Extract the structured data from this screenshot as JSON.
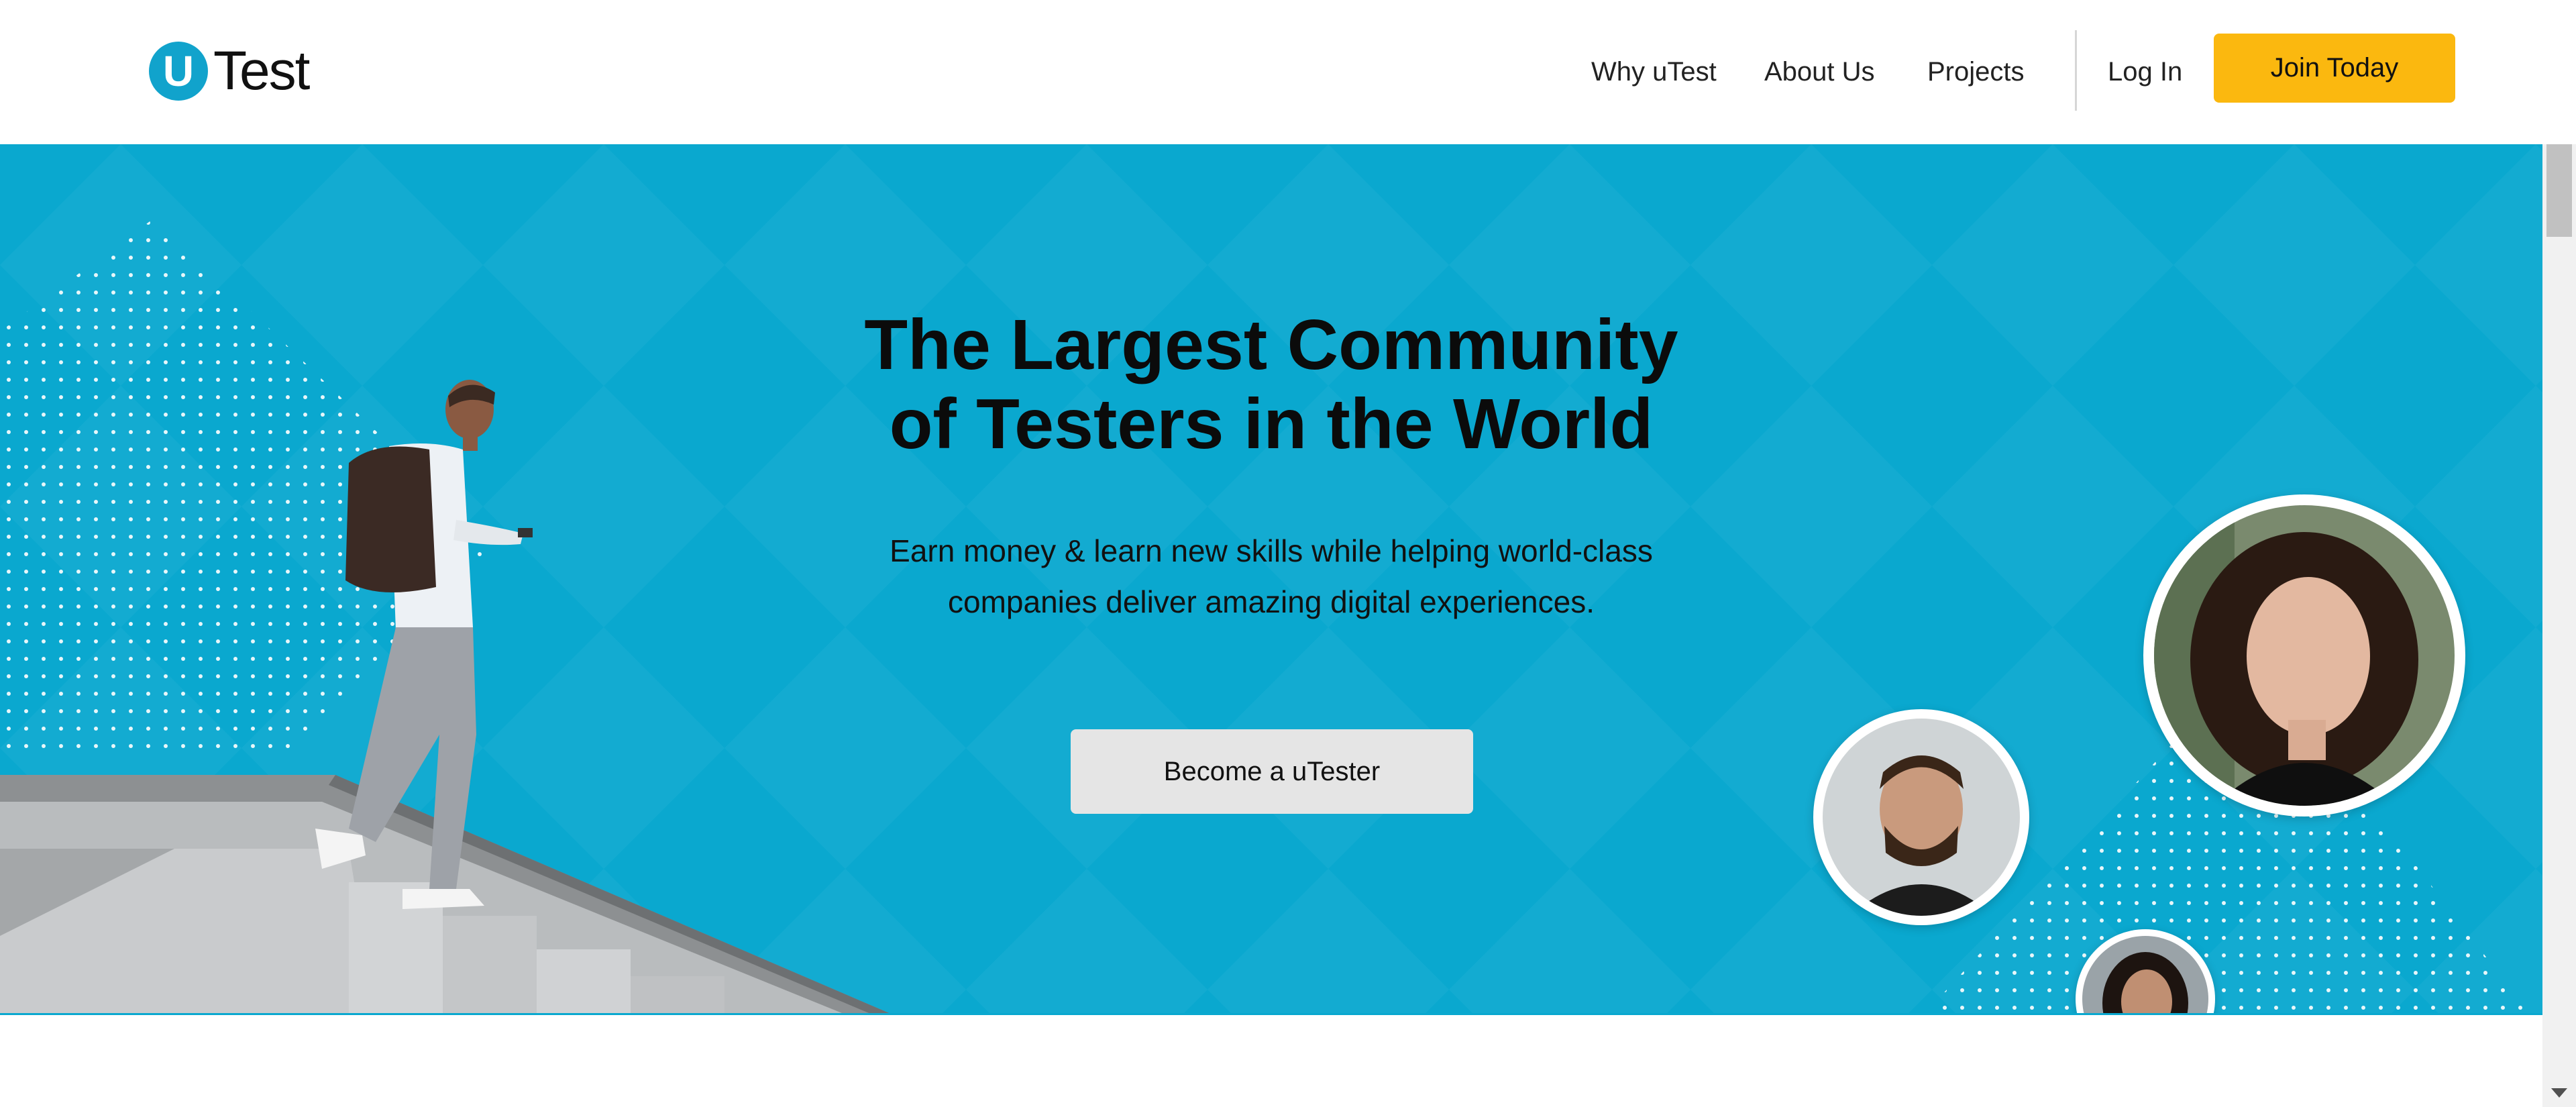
{
  "brand": {
    "mark": "U",
    "name": "Test",
    "color": "#11a3cc"
  },
  "nav": {
    "links": [
      {
        "label": "Why uTest"
      },
      {
        "label": "About Us"
      },
      {
        "label": "Projects"
      }
    ],
    "login_label": "Log In",
    "join_label": "Join Today",
    "join_color": "#fbb80f"
  },
  "hero": {
    "background": "#0aa8cf",
    "title_line1": "The Largest Community",
    "title_line2": "of Testers in the World",
    "subtitle_line1": "Earn money & learn new skills while helping world-class",
    "subtitle_line2": "companies deliver amazing digital experiences.",
    "cta_label": "Become a uTester"
  },
  "icons": {
    "scroll_down": "chevron-down-icon"
  }
}
